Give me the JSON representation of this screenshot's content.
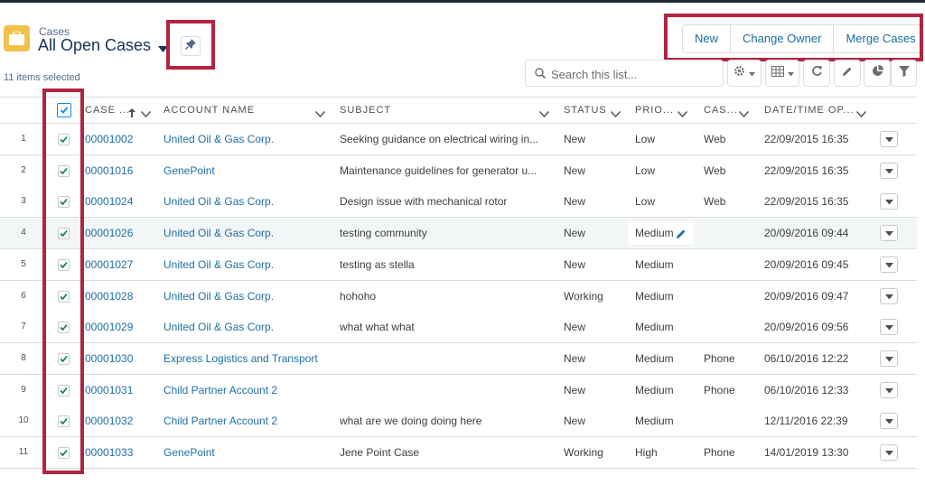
{
  "header": {
    "object_label": "Cases",
    "list_view_title": "All Open Cases",
    "items_selected": "11 items selected"
  },
  "actions": {
    "new_label": "New",
    "change_owner_label": "Change Owner",
    "merge_cases_label": "Merge Cases"
  },
  "search": {
    "placeholder": "Search this list..."
  },
  "toolbar_icons": [
    "gear-icon",
    "table-view-icon",
    "refresh-icon",
    "pencil-icon",
    "chart-icon",
    "filter-icon"
  ],
  "columns": {
    "case": "CASE ...",
    "account": "ACCOUNT NAME",
    "subject": "SUBJECT",
    "status": "STATUS",
    "priority": "PRIO...",
    "case_origin": "CAS...",
    "opened": "DATE/TIME OP..."
  },
  "rows": [
    {
      "num": "1",
      "case": "00001002",
      "account": "United Oil & Gas Corp.",
      "subject": "Seeking guidance on electrical wiring in...",
      "status": "New",
      "priority": "Low",
      "origin": "Web",
      "opened": "22/09/2015 16:35"
    },
    {
      "num": "2",
      "case": "00001016",
      "account": "GenePoint",
      "subject": "Maintenance guidelines for generator u...",
      "status": "New",
      "priority": "Low",
      "origin": "Web",
      "opened": "22/09/2015 16:35"
    },
    {
      "num": "3",
      "case": "00001024",
      "account": "United Oil & Gas Corp.",
      "subject": "Design issue with mechanical rotor",
      "status": "New",
      "priority": "Low",
      "origin": "Web",
      "opened": "22/09/2015 16:35"
    },
    {
      "num": "4",
      "case": "00001026",
      "account": "United Oil & Gas Corp.",
      "subject": "testing community",
      "status": "New",
      "priority": "Medium",
      "origin": "",
      "opened": "20/09/2016 09:44"
    },
    {
      "num": "5",
      "case": "00001027",
      "account": "United Oil & Gas Corp.",
      "subject": "testing as stella",
      "status": "New",
      "priority": "Medium",
      "origin": "",
      "opened": "20/09/2016 09:45"
    },
    {
      "num": "6",
      "case": "00001028",
      "account": "United Oil & Gas Corp.",
      "subject": "hohoho",
      "status": "Working",
      "priority": "Medium",
      "origin": "",
      "opened": "20/09/2016 09:47"
    },
    {
      "num": "7",
      "case": "00001029",
      "account": "United Oil & Gas Corp.",
      "subject": "what what what",
      "status": "New",
      "priority": "Medium",
      "origin": "",
      "opened": "20/09/2016 09:56"
    },
    {
      "num": "8",
      "case": "00001030",
      "account": "Express Logistics and Transport",
      "subject": "",
      "status": "New",
      "priority": "Medium",
      "origin": "Phone",
      "opened": "06/10/2016 12:22"
    },
    {
      "num": "9",
      "case": "00001031",
      "account": "Child Partner Account 2",
      "subject": "",
      "status": "New",
      "priority": "Medium",
      "origin": "Phone",
      "opened": "06/10/2016 12:33"
    },
    {
      "num": "10",
      "case": "00001032",
      "account": "Child Partner Account 2",
      "subject": "what are we doing doing here",
      "status": "New",
      "priority": "Medium",
      "origin": "",
      "opened": "12/11/2016 22:39"
    },
    {
      "num": "11",
      "case": "00001033",
      "account": "GenePoint",
      "subject": "Jene Point Case",
      "status": "Working",
      "priority": "High",
      "origin": "Phone",
      "opened": "14/01/2019 13:30"
    }
  ],
  "colors": {
    "link": "#1e6fa6",
    "highlight_box": "#b22442",
    "object_icon": "#f0c24b"
  }
}
